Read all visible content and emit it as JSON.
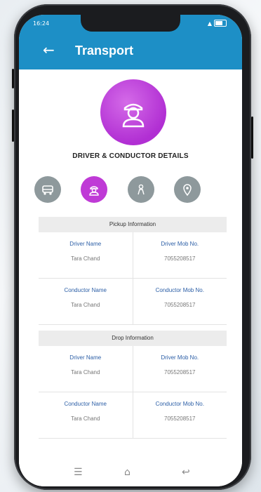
{
  "status_bar": {
    "time": "16:24",
    "battery": ""
  },
  "app_bar": {
    "title": "Transport",
    "back_icon": "arrow-left-icon"
  },
  "section": {
    "title": "DRIVER & CONDUCTOR DETAILS",
    "avatar_icon": "driver-icon"
  },
  "tabs": [
    {
      "icon": "bus-icon",
      "active": false
    },
    {
      "icon": "driver-icon",
      "active": true
    },
    {
      "icon": "person-location-icon",
      "active": false
    },
    {
      "icon": "map-pin-icon",
      "active": false
    }
  ],
  "pickup": {
    "header": "Pickup Information",
    "rows": [
      {
        "left_label": "Driver Name",
        "left_value": "Tara Chand",
        "right_label": "Driver Mob No.",
        "right_value": "7055208517"
      },
      {
        "left_label": "Conductor Name",
        "left_value": "Tara Chand",
        "right_label": "Conductor Mob No.",
        "right_value": "7055208517"
      }
    ]
  },
  "drop": {
    "header": "Drop Information",
    "rows": [
      {
        "left_label": "Driver Name",
        "left_value": "Tara Chand",
        "right_label": "Driver Mob No.",
        "right_value": "7055208517"
      },
      {
        "left_label": "Conductor Name",
        "left_value": "Tara Chand",
        "right_label": "Conductor Mob No.",
        "right_value": "7055208517"
      }
    ]
  },
  "colors": {
    "primary": "#1d8fc6",
    "accent": "#bf3ad6",
    "label": "#2b5ea6",
    "muted_icon": "#8e999c"
  }
}
